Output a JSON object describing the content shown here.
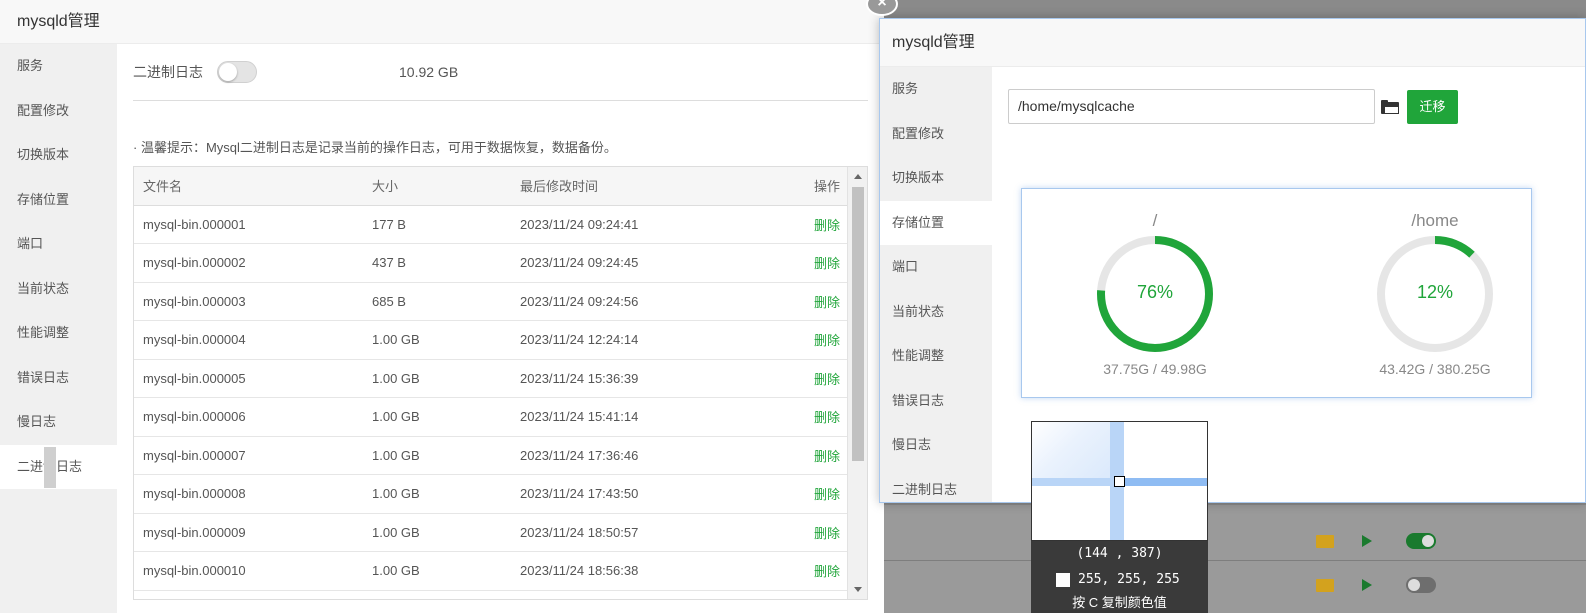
{
  "left_window": {
    "title": "mysqld管理",
    "sidebar": [
      "服务",
      "配置修改",
      "切换版本",
      "存储位置",
      "端口",
      "当前状态",
      "性能调整",
      "错误日志",
      "慢日志",
      "二进制日志"
    ],
    "active_index": 9,
    "binlog": {
      "label": "二进制日志",
      "size": "10.92 GB",
      "tip": "· 温馨提示：Mysql二进制日志是记录当前的操作日志，可用于数据恢复，数据备份。",
      "columns": [
        "文件名",
        "大小",
        "最后修改时间",
        "操作"
      ],
      "rows": [
        {
          "name": "mysql-bin.000001",
          "size": "177 B",
          "time": "2023/11/24 09:24:41",
          "op": "删除"
        },
        {
          "name": "mysql-bin.000002",
          "size": "437 B",
          "time": "2023/11/24 09:24:45",
          "op": "删除"
        },
        {
          "name": "mysql-bin.000003",
          "size": "685 B",
          "time": "2023/11/24 09:24:56",
          "op": "删除"
        },
        {
          "name": "mysql-bin.000004",
          "size": "1.00 GB",
          "time": "2023/11/24 12:24:14",
          "op": "删除"
        },
        {
          "name": "mysql-bin.000005",
          "size": "1.00 GB",
          "time": "2023/11/24 15:36:39",
          "op": "删除"
        },
        {
          "name": "mysql-bin.000006",
          "size": "1.00 GB",
          "time": "2023/11/24 15:41:14",
          "op": "删除"
        },
        {
          "name": "mysql-bin.000007",
          "size": "1.00 GB",
          "time": "2023/11/24 17:36:46",
          "op": "删除"
        },
        {
          "name": "mysql-bin.000008",
          "size": "1.00 GB",
          "time": "2023/11/24 17:43:50",
          "op": "删除"
        },
        {
          "name": "mysql-bin.000009",
          "size": "1.00 GB",
          "time": "2023/11/24 18:50:57",
          "op": "删除"
        },
        {
          "name": "mysql-bin.000010",
          "size": "1.00 GB",
          "time": "2023/11/24 18:56:38",
          "op": "删除"
        }
      ]
    }
  },
  "front_window": {
    "title": "mysqld管理",
    "close_label": "×",
    "sidebar": [
      "服务",
      "配置修改",
      "切换版本",
      "存储位置",
      "端口",
      "当前状态",
      "性能调整",
      "错误日志",
      "慢日志",
      "二进制日志"
    ],
    "active_index": 3,
    "storage": {
      "path": "/home/mysqlcache",
      "migrate_label": "迁移",
      "disks": [
        {
          "name": "/",
          "percent_label": "76%",
          "fraction": 0.76,
          "usage": "37.75G / 49.98G"
        },
        {
          "name": "/home",
          "percent_label": "12%",
          "fraction": 0.12,
          "usage": "43.42G / 380.25G"
        }
      ]
    }
  },
  "picker": {
    "coord": "(144 , 387)",
    "rgb": "255, 255, 255",
    "hint": "按 C 复制颜色值"
  },
  "colors": {
    "accent": "#20a53a",
    "track": "#e6e6e6"
  },
  "icons": [
    "folder-icon",
    "close-icon",
    "play-icon",
    "toggle-switch"
  ]
}
